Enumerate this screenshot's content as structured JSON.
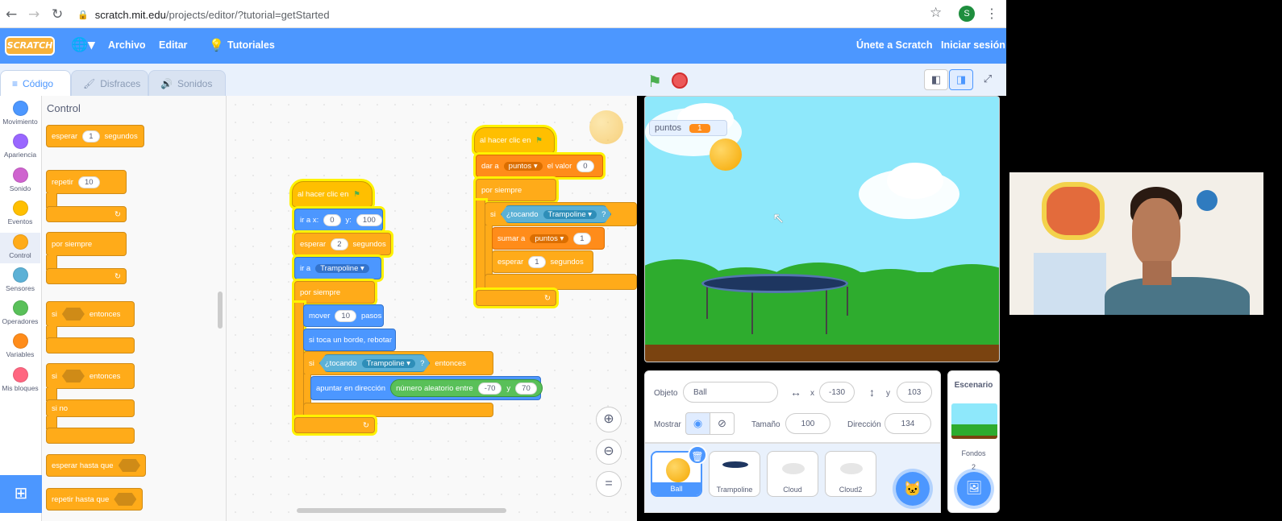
{
  "browser": {
    "url_host": "scratch.mit.edu",
    "url_path": "/projects/editor/?tutorial=getStarted",
    "avatar_letter": "S"
  },
  "menubar": {
    "logo": "SCRATCH",
    "file": "Archivo",
    "edit": "Editar",
    "tutorials": "Tutoriales",
    "join": "Únete a Scratch",
    "signin": "Iniciar sesión"
  },
  "tabs": {
    "code": "Código",
    "costumes": "Disfraces",
    "sounds": "Sonidos"
  },
  "categories": [
    {
      "label": "Movimiento",
      "color": "#4c97ff"
    },
    {
      "label": "Apariencia",
      "color": "#9966ff"
    },
    {
      "label": "Sonido",
      "color": "#cf63cf"
    },
    {
      "label": "Eventos",
      "color": "#ffbf00"
    },
    {
      "label": "Control",
      "color": "#ffab19"
    },
    {
      "label": "Sensores",
      "color": "#5cb1d6"
    },
    {
      "label": "Operadores",
      "color": "#59c059"
    },
    {
      "label": "Variables",
      "color": "#ff8c1a"
    },
    {
      "label": "Mis bloques",
      "color": "#ff6680"
    }
  ],
  "palette": {
    "title": "Control",
    "wait": "esperar",
    "wait_val": "1",
    "wait_unit": "segundos",
    "repeat": "repetir",
    "repeat_val": "10",
    "forever": "por siempre",
    "if": "si",
    "then": "entonces",
    "if2": "si",
    "then2": "entonces",
    "else": "si no",
    "wait_until": "esperar hasta que",
    "repeat_until": "repetir hasta que"
  },
  "script1": {
    "hat": "al hacer clic en",
    "goto": "ir a x:",
    "x_val": "0",
    "y_lbl": "y:",
    "y_val": "100",
    "wait": "esperar",
    "wait_val": "2",
    "wait_unit": "segundos",
    "goto_target_lbl": "ir a",
    "goto_target": "Trampoline",
    "forever": "por siempre",
    "move": "mover",
    "move_val": "10",
    "move_unit": "pasos",
    "bounce": "si toca un borde, rebotar",
    "if": "si",
    "touching": "¿tocando",
    "touching_target": "Trampoline",
    "q": "?",
    "then": "entonces",
    "point": "apuntar en dirección",
    "random": "número aleatorio entre",
    "rand_from": "-70",
    "rand_and": "y",
    "rand_to": "70"
  },
  "script2": {
    "hat": "al hacer clic en",
    "set": "dar a",
    "set_var": "puntos",
    "set_mid": "el valor",
    "set_val": "0",
    "forever": "por siempre",
    "if": "si",
    "touching": "¿tocando",
    "touching_target": "Trampoline",
    "q": "?",
    "change": "sumar a",
    "change_var": "puntos",
    "change_val": "1",
    "wait": "esperar",
    "wait_val": "1",
    "wait_unit": "segundos"
  },
  "stage": {
    "monitor_label": "puntos",
    "monitor_value": "1"
  },
  "sprite_info": {
    "sprite_lbl": "Objeto",
    "sprite_name": "Ball",
    "x_lbl": "x",
    "x_val": "-130",
    "y_lbl": "y",
    "y_val": "103",
    "show_lbl": "Mostrar",
    "size_lbl": "Tamaño",
    "size_val": "100",
    "dir_lbl": "Dirección",
    "dir_val": "134"
  },
  "sprites": [
    "Ball",
    "Trampoline",
    "Cloud",
    "Cloud2"
  ],
  "stage_pane": {
    "title": "Escenario",
    "backdrops_lbl": "Fondos",
    "backdrops_count": "2"
  }
}
